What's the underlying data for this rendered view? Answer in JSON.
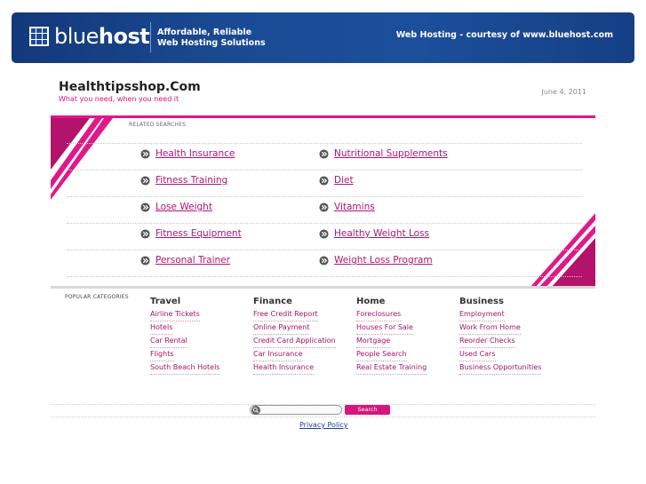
{
  "banner": {
    "brand_light": "blue",
    "brand_bold": "host",
    "tagline_line1": "Affordable, Reliable",
    "tagline_line2": "Web Hosting Solutions",
    "right_text": "Web Hosting - courtesy of www.bluehost.com"
  },
  "header": {
    "title": "Healthtipsshop.Com",
    "tagline": "What you need,  when you need it",
    "date": "June 4, 2011"
  },
  "related": {
    "label": "RELATED SEARCHES",
    "left": [
      "Health Insurance",
      "Fitness Training",
      "Lose Weight",
      "Fitness Equipment",
      "Personal Trainer"
    ],
    "right": [
      "Nutritional Supplements",
      "Diet",
      "Vitamins",
      "Healthy Weight Loss",
      "Weight Loss Program"
    ]
  },
  "popular": {
    "label": "POPULAR CATEGORIES",
    "categories": [
      {
        "title": "Travel",
        "links": [
          "Airline Tickets",
          "Hotels",
          "Car Rental",
          "Flights",
          "South Beach Hotels"
        ]
      },
      {
        "title": "Finance",
        "links": [
          "Free Credit Report",
          "Online Payment",
          "Credit Card Application",
          "Car Insurance",
          "Health Insurance"
        ]
      },
      {
        "title": "Home",
        "links": [
          "Foreclosures",
          "Houses For Sale",
          "Mortgage",
          "People Search",
          "Real Estate Training"
        ]
      },
      {
        "title": "Business",
        "links": [
          "Employment",
          "Work From Home",
          "Reorder Checks",
          "Used Cars",
          "Business Opportunities"
        ]
      }
    ]
  },
  "search": {
    "placeholder": "",
    "button_label": "Search"
  },
  "footer": {
    "privacy": "Privacy Policy"
  },
  "colors": {
    "accent": "#e0188a",
    "link": "#b01570",
    "banner": "#1a4a94"
  }
}
